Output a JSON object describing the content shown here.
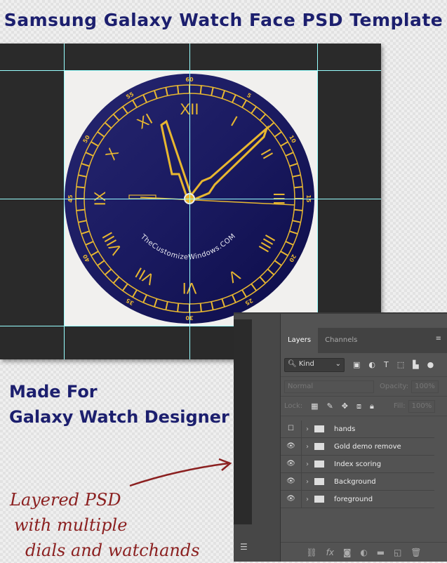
{
  "title": "Samsung Galaxy Watch Face PSD Template",
  "made_for": [
    "Made For",
    "Galaxy Watch Designer"
  ],
  "handwritten": [
    "Layered PSD",
    "with multiple",
    "dials and watchands"
  ],
  "watch": {
    "watermark": "TheCustomizeWindows.COM",
    "romans": [
      "XII",
      "I",
      "II",
      "III",
      "IIII",
      "V",
      "VI",
      "VII",
      "VIII",
      "IX",
      "X",
      "XI"
    ],
    "minute_labels": [
      "60",
      "5",
      "10",
      "15",
      "20",
      "25",
      "30",
      "35",
      "40",
      "45",
      "50",
      "55"
    ],
    "dial_color": "#15155c",
    "gold": "#e8b730"
  },
  "layers_panel": {
    "tabs": [
      "Layers",
      "Channels"
    ],
    "kind": "Kind",
    "blend": "Normal",
    "opacity_label": "Opacity:",
    "opacity": "100%",
    "lock_label": "Lock:",
    "fill_label": "Fill:",
    "fill": "100%",
    "layers": [
      {
        "name": "hands",
        "visible": false
      },
      {
        "name": "Gold demo remove",
        "visible": true
      },
      {
        "name": "Index scoring",
        "visible": true
      },
      {
        "name": "Background",
        "visible": true
      },
      {
        "name": "foreground",
        "visible": true
      }
    ]
  }
}
